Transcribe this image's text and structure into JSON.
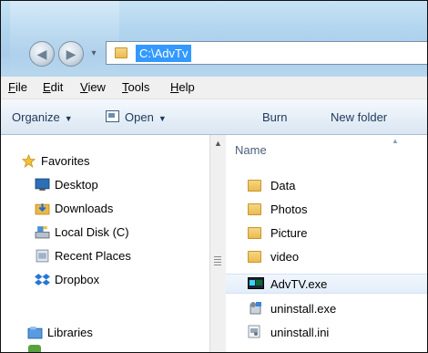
{
  "window": {
    "address": "C:\\AdvTv"
  },
  "menu": [
    {
      "label": "File",
      "hotkey": "F",
      "rest": "ile"
    },
    {
      "label": "Edit",
      "hotkey": "E",
      "rest": "dit"
    },
    {
      "label": "View",
      "hotkey": "V",
      "rest": "iew"
    },
    {
      "label": "Tools",
      "hotkey": "T",
      "rest": "ools"
    },
    {
      "label": "Help",
      "hotkey": "H",
      "rest": "elp"
    }
  ],
  "toolbar": {
    "organize": "Organize",
    "open": "Open",
    "burn": "Burn",
    "new_folder": "New folder"
  },
  "nav": {
    "favorites": "Favorites",
    "desktop": "Desktop",
    "downloads": "Downloads",
    "local_disk": "Local Disk (C)",
    "recent_places": "Recent Places",
    "dropbox": "Dropbox",
    "libraries": "Libraries"
  },
  "content": {
    "column_name": "Name",
    "files": [
      {
        "name": "Data",
        "type": "folder"
      },
      {
        "name": "Photos",
        "type": "folder"
      },
      {
        "name": "Picture",
        "type": "folder"
      },
      {
        "name": "video",
        "type": "folder"
      },
      {
        "name": "AdvTV.exe",
        "type": "exe",
        "selected": true
      },
      {
        "name": "uninstall.exe",
        "type": "setup-exe"
      },
      {
        "name": "uninstall.ini",
        "type": "ini"
      }
    ]
  }
}
